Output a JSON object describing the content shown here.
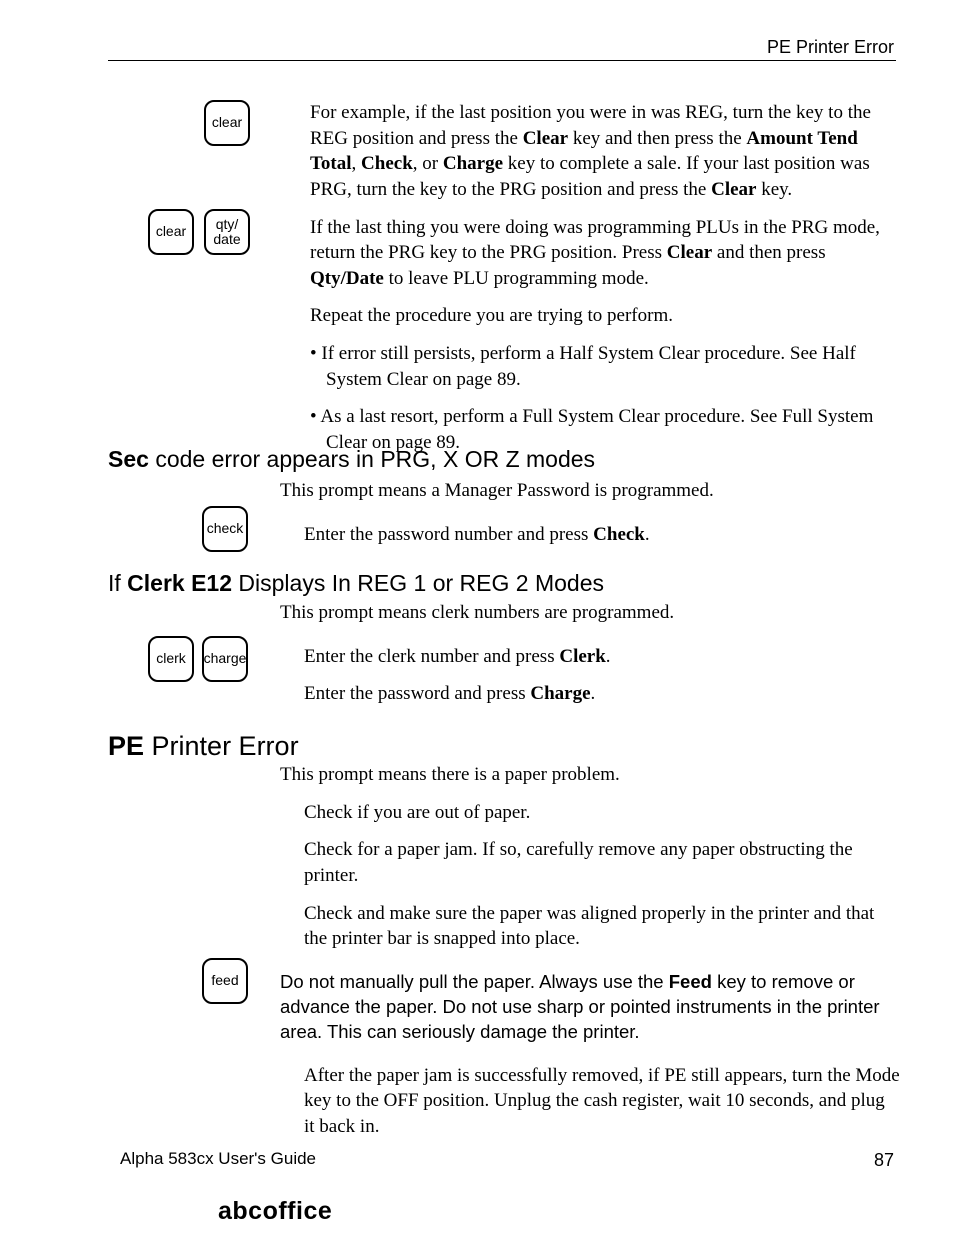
{
  "header": {
    "running": "PE Printer Error"
  },
  "footer": {
    "guide": "Alpha 583cx  User's Guide",
    "page": "87",
    "brand": "abcoffice"
  },
  "keys": {
    "clear": "clear",
    "qty_date": "qty/\ndate",
    "check": "check",
    "clerk": "clerk",
    "charge": "charge",
    "feed": "feed"
  },
  "sec1": {
    "p1_a": "For example, if the last position you were in was REG, turn the key to the REG position and press the ",
    "p1_b": "Clear",
    "p1_c": " key and then press the ",
    "p1_d": "Amount Tend Total",
    "p1_e": ", ",
    "p1_f": "Check",
    "p1_g": ", or ",
    "p1_h": "Charge",
    "p1_i": " key to complete a sale. If your last position was PRG, turn the key to the PRG position and press the ",
    "p1_j": "Clear",
    "p1_k": " key.",
    "p2_a": "If the last thing you were doing was programming PLUs in the PRG mode, return the PRG key to the PRG position. Press ",
    "p2_b": "Clear",
    "p2_c": " and then press ",
    "p2_d": "Qty/Date",
    "p2_e": " to leave PLU programming mode.",
    "p3": "Repeat the procedure you are trying to perform.",
    "b1": "• If error still persists, perform a Half System Clear procedure. See Half System Clear on page 89.",
    "b2": "• As a last resort, perform a Full System Clear procedure. See Full System Clear on page 89."
  },
  "sec2": {
    "h_a": "Sec",
    "h_b": " code error appears in PRG, X OR Z modes",
    "p1": "This prompt means a Manager Password is programmed.",
    "p2_a": "Enter the password number and press ",
    "p2_b": "Check",
    "p2_c": "."
  },
  "sec3": {
    "h_a": "If ",
    "h_b": "Clerk E12",
    "h_c": " Displays In REG 1 or REG 2 Modes",
    "p1": "This prompt means clerk numbers are programmed.",
    "p2_a": "Enter the clerk number and press ",
    "p2_b": "Clerk",
    "p2_c": ".",
    "p3_a": "Enter the password and press ",
    "p3_b": "Charge",
    "p3_c": "."
  },
  "sec4": {
    "h_a": "PE",
    "h_b": " Printer Error",
    "p1": "This prompt means there is a paper problem.",
    "s1": "Check if you are out of paper.",
    "s2": "Check for a paper jam. If so, carefully remove any paper obstructing the printer.",
    "s3": "Check and make sure the paper was aligned properly in the printer and that the printer bar is snapped into place.",
    "note_a": "Do not manually pull the paper. Always use the ",
    "note_b": "Feed",
    "note_c": " key to remove or advance the paper. Do not use sharp or pointed instruments in the printer area. This can seriously damage the printer.",
    "s4": "After the paper jam is successfully removed, if PE still appears, turn the Mode key to the OFF position. Unplug the cash register, wait 10 seconds, and plug it back in."
  }
}
